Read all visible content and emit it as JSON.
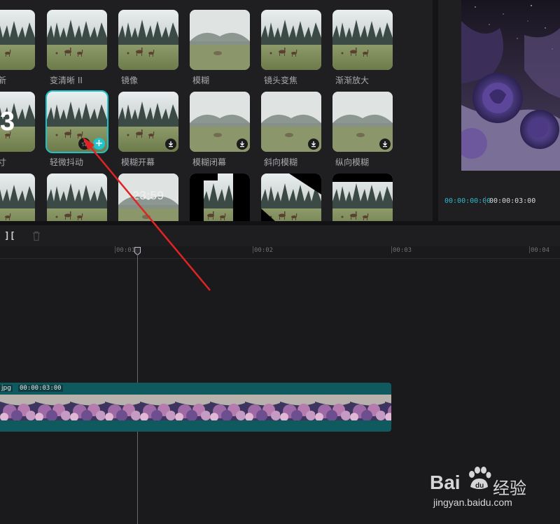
{
  "effects": {
    "row1": [
      {
        "label": "新",
        "style": "deer"
      },
      {
        "label": "变清晰 II",
        "style": "deer"
      },
      {
        "label": "镜像",
        "style": "deer"
      },
      {
        "label": "模糊",
        "style": "blur"
      },
      {
        "label": "镜头变焦",
        "style": "deer"
      },
      {
        "label": "渐渐放大",
        "style": "deer"
      }
    ],
    "row2": [
      {
        "label": "寸",
        "style": "three"
      },
      {
        "label": "轻微抖动",
        "style": "deer",
        "selected": true
      },
      {
        "label": "模糊开幕",
        "style": "deer"
      },
      {
        "label": "模糊闭幕",
        "style": "blur"
      },
      {
        "label": "斜向模糊",
        "style": "blur"
      },
      {
        "label": "纵向模糊",
        "style": "blur"
      }
    ],
    "row3": [
      {
        "label": "",
        "style": "deer"
      },
      {
        "label": "",
        "style": "deer"
      },
      {
        "label": "",
        "style": "clock",
        "clock_text": "23:59"
      },
      {
        "label": "",
        "style": "bars"
      },
      {
        "label": "",
        "style": "diag"
      },
      {
        "label": "",
        "style": "deer"
      }
    ]
  },
  "preview": {
    "time_current": "00:00:00:00",
    "time_total": "00:00:03:00"
  },
  "toolbar": {
    "split_glyph": "][",
    "delete_label": "delete"
  },
  "ruler": {
    "ticks": [
      "00:01",
      "00:02",
      "00:03",
      "00:04"
    ]
  },
  "track": {
    "clip_name": "jpg",
    "clip_duration": "00:00:03:00"
  },
  "watermark": {
    "brand": "Bai",
    "brand_cn": "经验",
    "url": "jingyan.baidu.com"
  },
  "colors": {
    "accent": "#20c4cb",
    "arrow": "#e02424",
    "clip": "#0e5a5e"
  }
}
